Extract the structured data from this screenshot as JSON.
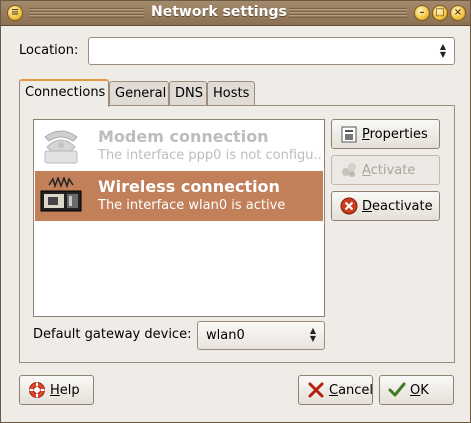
{
  "window": {
    "title": "Network settings"
  },
  "location": {
    "label": "Location:",
    "value": ""
  },
  "tabs": [
    {
      "label": "Connections",
      "active": true
    },
    {
      "label": "General",
      "active": false
    },
    {
      "label": "DNS",
      "active": false
    },
    {
      "label": "Hosts",
      "active": false
    }
  ],
  "connections": [
    {
      "name": "Modem connection",
      "description": "The interface ppp0 is not configu...",
      "icon": "modem-phone-icon",
      "selected": false
    },
    {
      "name": "Wireless connection",
      "description": "The interface wlan0 is active",
      "icon": "wireless-card-icon",
      "selected": true
    }
  ],
  "buttons": {
    "properties": {
      "label_rest": "roperties",
      "mnemonic": "P",
      "icon": "properties-icon"
    },
    "activate": {
      "label_rest": "ctivate",
      "mnemonic": "A",
      "icon": "activate-icon",
      "disabled": true
    },
    "deactivate": {
      "label_rest": "eactivate",
      "mnemonic": "D",
      "icon": "deactivate-icon"
    },
    "help": {
      "label_rest": "elp",
      "mnemonic": "H",
      "icon": "help-lifebuoy-icon"
    },
    "cancel": {
      "label_rest": "ancel",
      "mnemonic": "C",
      "icon": "cancel-x-icon"
    },
    "ok": {
      "label_rest": "K",
      "mnemonic": "O",
      "icon": "ok-check-icon"
    }
  },
  "gateway": {
    "label": "Default gateway device:",
    "value": "wlan0"
  },
  "colors": {
    "titlebar": "#9c8262",
    "selection": "#c1805a",
    "accent": "#e49a3c",
    "background": "#efebe7"
  }
}
